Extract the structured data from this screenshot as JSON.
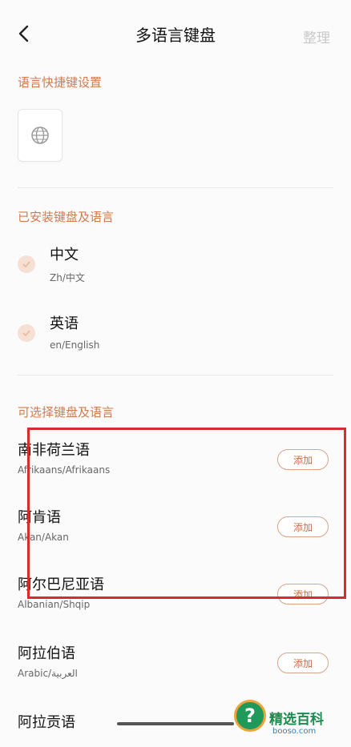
{
  "header": {
    "title": "多语言键盘",
    "action_label": "整理"
  },
  "sections": {
    "shortcut": {
      "title": "语言快捷键设置"
    },
    "installed": {
      "title": "已安装键盘及语言",
      "items": [
        {
          "main": "中文",
          "sub": "Zh/中文"
        },
        {
          "main": "英语",
          "sub": "en/English"
        }
      ]
    },
    "available": {
      "title": "可选择键盘及语言",
      "items": [
        {
          "main": "南非荷兰语",
          "sub": "Afrikaans/Afrikaans",
          "button": "添加"
        },
        {
          "main": "阿肯语",
          "sub": "Akan/Akan",
          "button": "添加"
        },
        {
          "main": "阿尔巴尼亚语",
          "sub": "Albanian/Shqip",
          "button": "添加"
        },
        {
          "main": "阿拉伯语",
          "sub": "Arabic/العربية",
          "button": "添加"
        },
        {
          "main": "阿拉贡语",
          "sub": "",
          "button": ""
        }
      ]
    }
  },
  "watermark": {
    "text": "精选百科",
    "domain": "booso.com"
  },
  "colors": {
    "accent": "#d07b4f",
    "highlight_frame": "#d92b2b"
  },
  "icons": {
    "back": "chevron-left-icon",
    "globe": "globe-icon",
    "check": "check-icon",
    "help": "question-icon"
  }
}
